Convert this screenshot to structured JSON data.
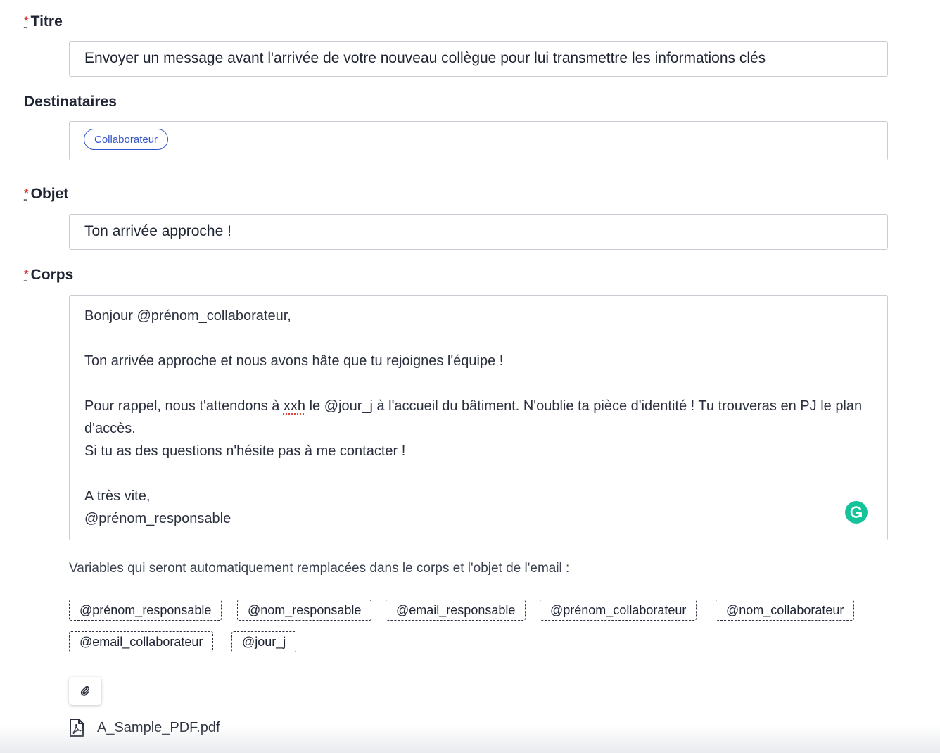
{
  "fields": {
    "titre": {
      "label": "Titre",
      "required": true,
      "value": "Envoyer un message avant l'arrivée de votre nouveau collègue pour lui transmettre les informations clés"
    },
    "destinataires": {
      "label": "Destinataires",
      "required": false,
      "chips": [
        "Collaborateur"
      ]
    },
    "objet": {
      "label": "Objet",
      "required": true,
      "value": "Ton arrivée approche !"
    },
    "corps": {
      "label": "Corps",
      "required": true,
      "lines": {
        "l1": "Bonjour @prénom_collaborateur,",
        "l2": "",
        "l3": "Ton arrivée approche et nous avons hâte que tu rejoignes l'équipe !",
        "l4": "",
        "l5_before": "Pour rappel, nous t'attendons à ",
        "l5_typo": "xxh",
        "l5_after": " le @jour_j à l'accueil du bâtiment. N'oublie ta pièce d'identité ! Tu trouveras en PJ le plan d'accès.",
        "l6": "Si tu as des questions n'hésite pas à me contacter !",
        "l7": "",
        "l8": "A très vite,",
        "l9": "@prénom_responsable"
      },
      "assistant_icon": "grammarly-icon"
    }
  },
  "variables": {
    "intro": "Variables qui seront automatiquement remplacées dans le corps et l'objet de l'email :",
    "items": [
      "@prénom_responsable",
      "@nom_responsable",
      "@email_responsable",
      "@prénom_collaborateur",
      "@nom_collaborateur",
      "@email_collaborateur",
      "@jour_j"
    ]
  },
  "attachments": {
    "button_icon": "paperclip-icon",
    "files": [
      {
        "name": "A_Sample_PDF.pdf",
        "icon": "pdf-file-icon"
      }
    ]
  },
  "colors": {
    "required_marker": "#d63b3b",
    "chip_accent": "#3556c8",
    "grammarly": "#15c39a"
  }
}
